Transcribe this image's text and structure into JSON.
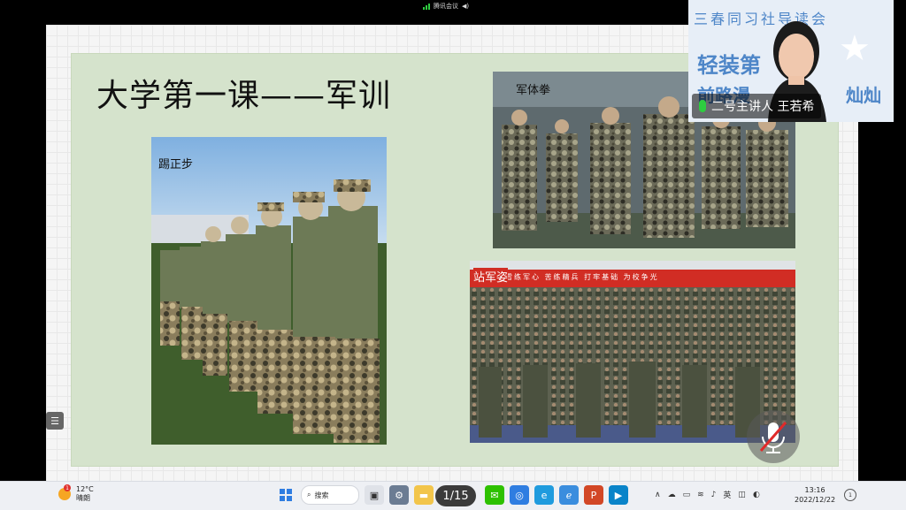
{
  "window": {
    "title": "腾讯会议"
  },
  "slide": {
    "title": "大学第一课——军训",
    "photos": [
      {
        "caption": "踢正步"
      },
      {
        "caption": "军体拳"
      },
      {
        "caption": "站军姿"
      }
    ],
    "banner_slogan": "雪练军心 苦练精兵 打牢基础 为校争光"
  },
  "video": {
    "banner_line1": "三春同习社导读会",
    "banner_line2": "轻装第",
    "banner_line3": "前路漫",
    "banner_line4": "灿灿",
    "speaker_label": "二号主讲人 王若希"
  },
  "toolbar": {
    "page_indicator": "1/15",
    "side_handle_glyph": "☰"
  },
  "taskbar": {
    "weather_temp": "12°C",
    "weather_desc": "晴朗",
    "weather_badge": "1",
    "search_label": "搜索",
    "ime_label": "英",
    "time": "13:16",
    "date": "2022/12/22",
    "notify_badge": "1"
  },
  "colors": {
    "slide_bg": "#d5e3cc",
    "accent_blue": "#2f7de1",
    "mic_green": "#2ecc40",
    "office_red": "#d24726"
  }
}
